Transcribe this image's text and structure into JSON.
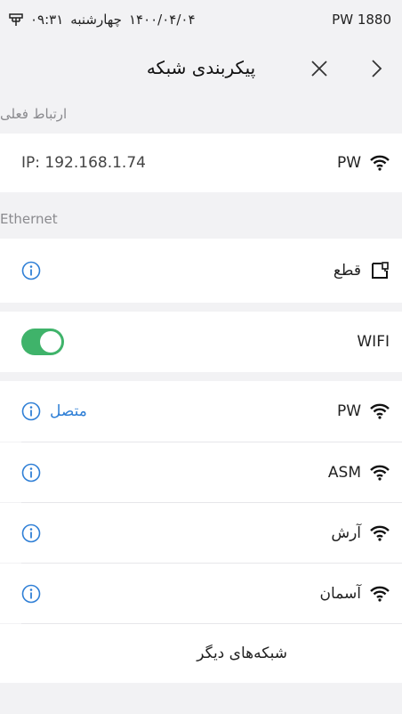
{
  "statusbar": {
    "time": "۰۹:۳۱",
    "day": "چهارشنبه",
    "date": "۱۴۰۰/۰۴/۰۴",
    "device": "PW 1880"
  },
  "navbar": {
    "title": "پیکربندی شبکه"
  },
  "current_connection": {
    "header": "ارتباط فعلی",
    "ssid": "PW",
    "ip": "IP:  192.168.1.74"
  },
  "ethernet": {
    "header": "Ethernet",
    "status": "قطع"
  },
  "wifi": {
    "label": "WIFI",
    "enabled": true,
    "networks": [
      {
        "ssid": "PW",
        "status": "متصل"
      },
      {
        "ssid": "ASM",
        "status": ""
      },
      {
        "ssid": "آرش",
        "status": ""
      },
      {
        "ssid": "آسمان",
        "status": ""
      }
    ],
    "other_networks": "شبکه‌های دیگر"
  },
  "colors": {
    "accent": "#2f7fd6",
    "toggle_on": "#3fb36a",
    "background": "#f2f2f4"
  }
}
